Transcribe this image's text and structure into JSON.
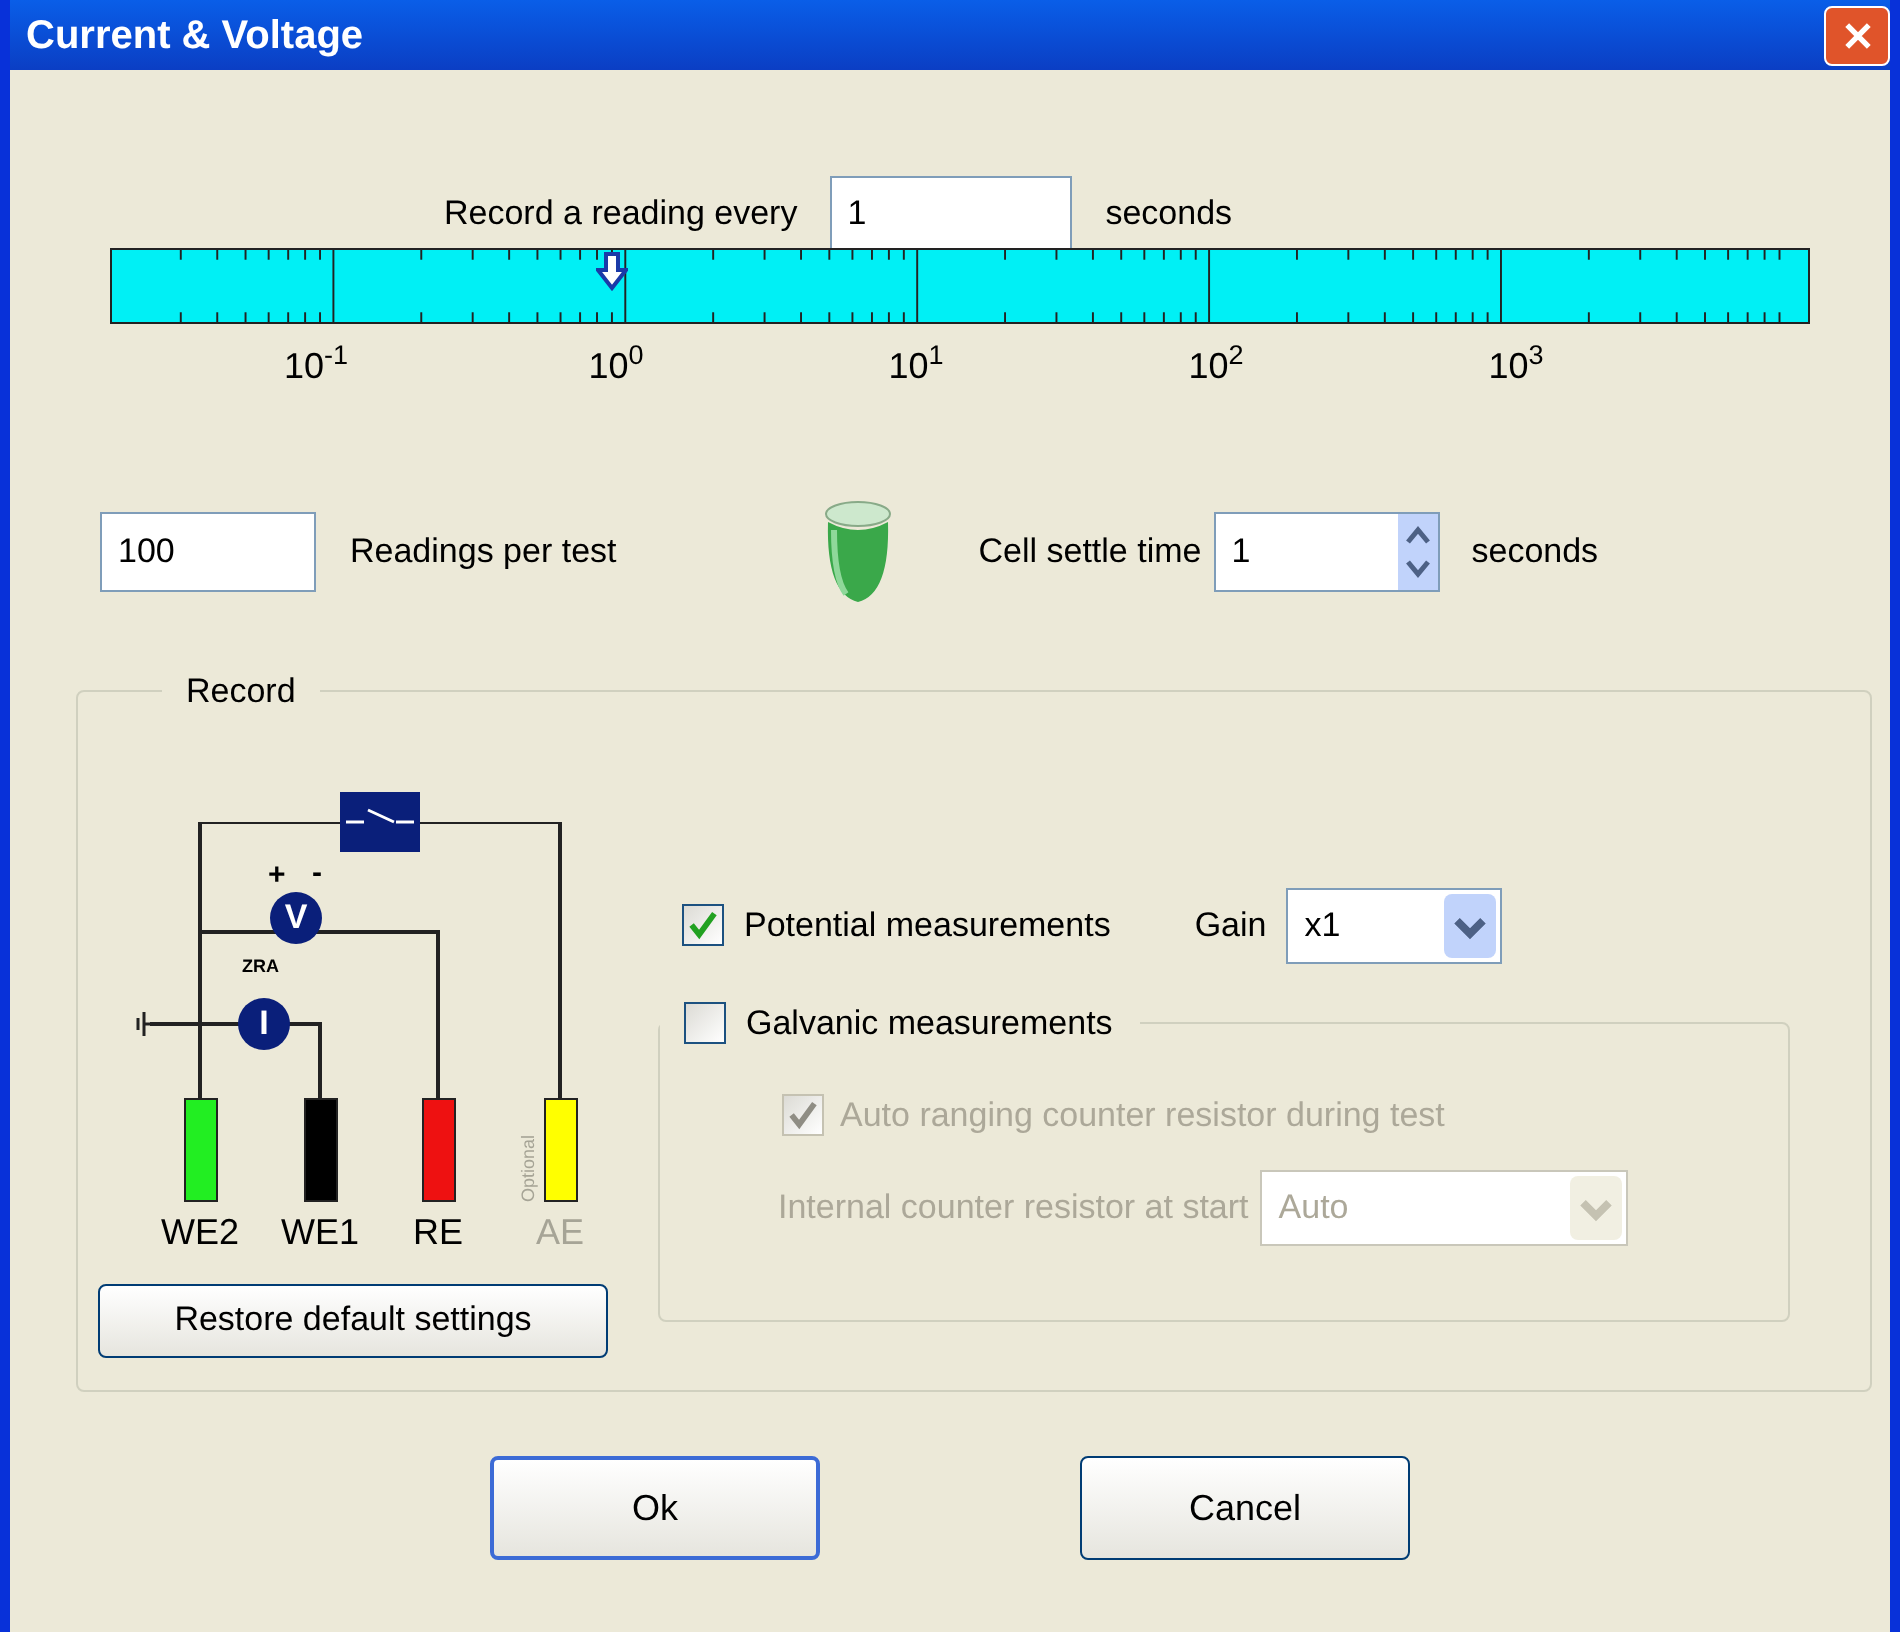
{
  "window": {
    "title": "Current & Voltage"
  },
  "interval": {
    "label": "Record a reading every",
    "value": "1",
    "unit": "seconds",
    "level": 0.295
  },
  "scale_labels": [
    "10$^{-1}$",
    "10$^{0}$",
    "10$^{1}$",
    "10$^{2}$",
    "10$^{3}$"
  ],
  "readings": {
    "value": "100",
    "label": "Readings per test"
  },
  "settle": {
    "label": "Cell settle time",
    "value": "1",
    "unit": "seconds"
  },
  "record": {
    "legend": "Record",
    "circuit": {
      "plus": "+",
      "minus": "-",
      "voltmeter": "V",
      "ammeter": "I",
      "zra": "ZRA",
      "electrodes": [
        {
          "label": "WE2",
          "color": "#22ee22",
          "optional": false
        },
        {
          "label": "WE1",
          "color": "#000000",
          "optional": false
        },
        {
          "label": "RE",
          "color": "#ee1111",
          "optional": false
        },
        {
          "label": "AE",
          "color": "#ffff00",
          "optional": true,
          "note": "Optional"
        }
      ]
    },
    "restore": "Restore default settings",
    "potential": {
      "label": "Potential measurements",
      "checked": true,
      "gain_label": "Gain",
      "gain": "x1"
    },
    "galvanic": {
      "label": "Galvanic measurements",
      "checked": false,
      "auto_ranging": {
        "label": "Auto ranging counter resistor during test",
        "checked": true,
        "disabled": true
      },
      "resistor": {
        "label": "Internal counter resistor at start",
        "value": "Auto",
        "disabled": true
      }
    }
  },
  "buttons": [
    {
      "label": "Ok",
      "default": true
    },
    {
      "label": "Cancel",
      "default": false
    }
  ]
}
